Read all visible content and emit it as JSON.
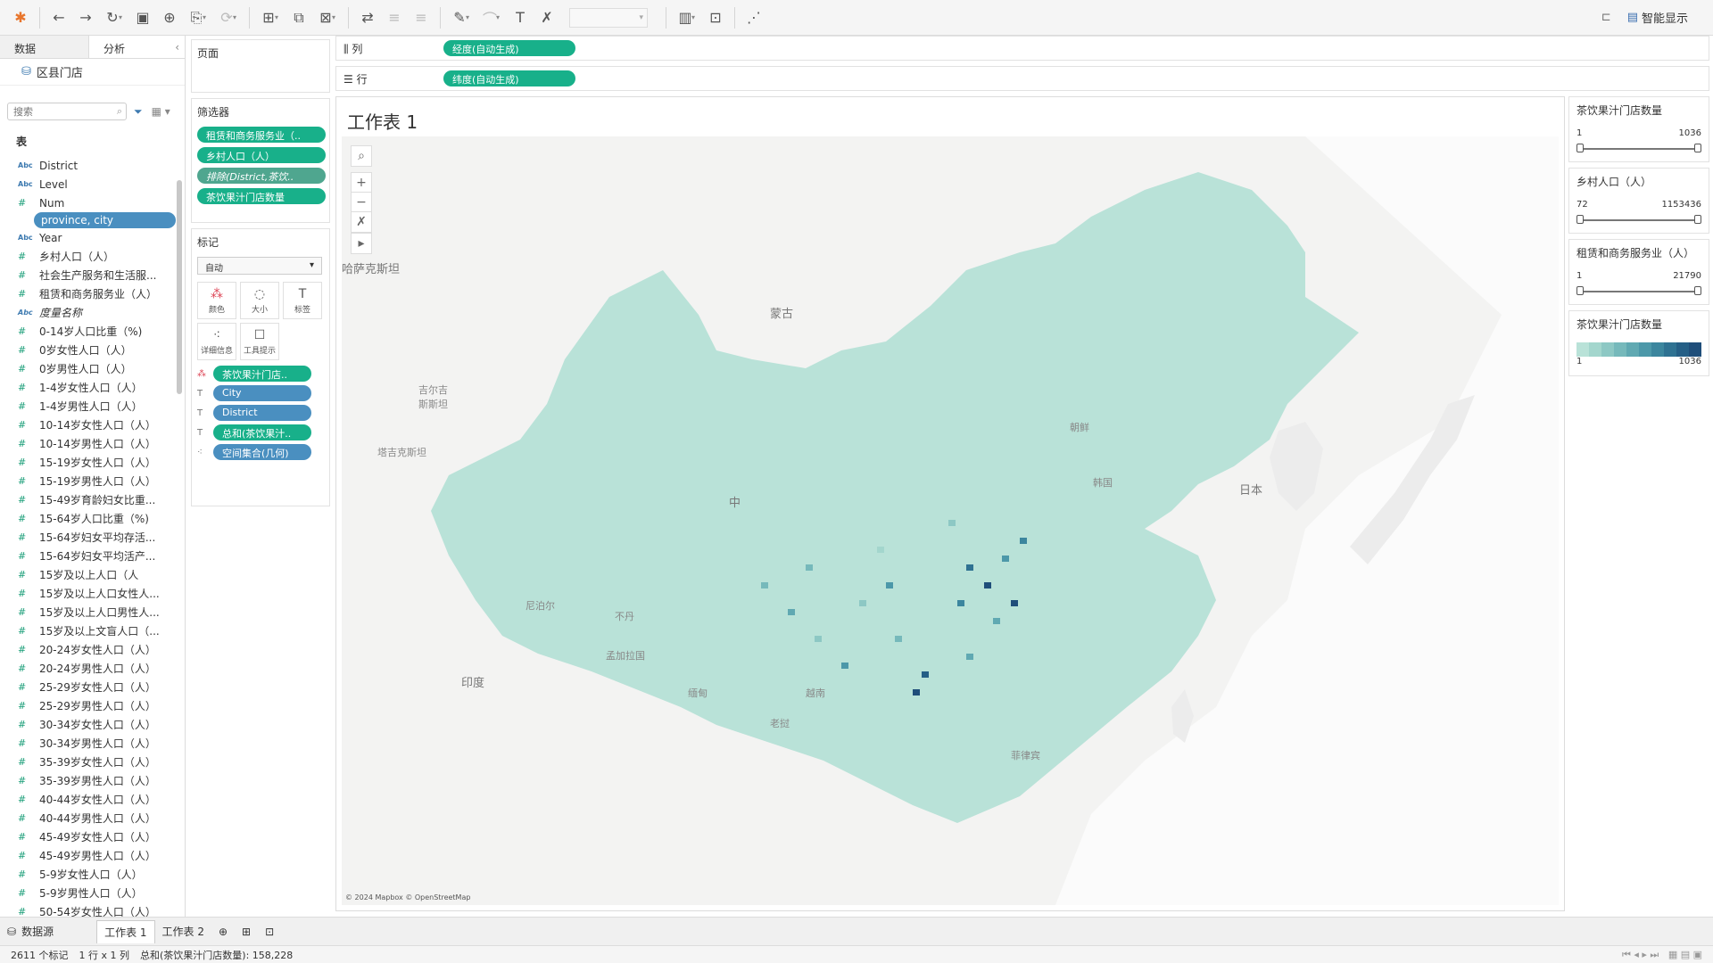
{
  "toolbar": {
    "smart_display": "智能显示"
  },
  "left": {
    "tabs": [
      "数据",
      "分析"
    ],
    "datasource": "区县门店",
    "search_placeholder": "搜索",
    "section": "表",
    "fields": [
      {
        "type": "Abc",
        "name": "District"
      },
      {
        "type": "Abc",
        "name": "Level"
      },
      {
        "type": "#",
        "name": "Num"
      },
      {
        "type": "geo",
        "name": "province, city",
        "selected": true
      },
      {
        "type": "Abc",
        "name": "Year"
      },
      {
        "type": "#",
        "name": "乡村人口（人）"
      },
      {
        "type": "#",
        "name": "社会生产服务和生活服..."
      },
      {
        "type": "#",
        "name": "租赁和商务服务业（人）"
      },
      {
        "type": "Abc",
        "name": "度量名称",
        "italic": true
      },
      {
        "type": "#",
        "name": "0-14岁人口比重（%)"
      },
      {
        "type": "#",
        "name": "0岁女性人口（人）"
      },
      {
        "type": "#",
        "name": "0岁男性人口（人）"
      },
      {
        "type": "#",
        "name": "1-4岁女性人口（人）"
      },
      {
        "type": "#",
        "name": "1-4岁男性人口（人）"
      },
      {
        "type": "#",
        "name": "10-14岁女性人口（人）"
      },
      {
        "type": "#",
        "name": "10-14岁男性人口（人）"
      },
      {
        "type": "#",
        "name": "15-19岁女性人口（人）"
      },
      {
        "type": "#",
        "name": "15-19岁男性人口（人）"
      },
      {
        "type": "#",
        "name": "15-49岁育龄妇女比重..."
      },
      {
        "type": "#",
        "name": "15-64岁人口比重（%)"
      },
      {
        "type": "#",
        "name": "15-64岁妇女平均存活..."
      },
      {
        "type": "#",
        "name": "15-64岁妇女平均活产..."
      },
      {
        "type": "#",
        "name": "15岁及以上人口（人"
      },
      {
        "type": "#",
        "name": "15岁及以上人口女性人..."
      },
      {
        "type": "#",
        "name": "15岁及以上人口男性人..."
      },
      {
        "type": "#",
        "name": "15岁及以上文盲人口（..."
      },
      {
        "type": "#",
        "name": "20-24岁女性人口（人）"
      },
      {
        "type": "#",
        "name": "20-24岁男性人口（人）"
      },
      {
        "type": "#",
        "name": "25-29岁女性人口（人）"
      },
      {
        "type": "#",
        "name": "25-29岁男性人口（人）"
      },
      {
        "type": "#",
        "name": "30-34岁女性人口（人）"
      },
      {
        "type": "#",
        "name": "30-34岁男性人口（人）"
      },
      {
        "type": "#",
        "name": "35-39岁女性人口（人）"
      },
      {
        "type": "#",
        "name": "35-39岁男性人口（人）"
      },
      {
        "type": "#",
        "name": "40-44岁女性人口（人）"
      },
      {
        "type": "#",
        "name": "40-44岁男性人口（人）"
      },
      {
        "type": "#",
        "name": "45-49岁女性人口（人）"
      },
      {
        "type": "#",
        "name": "45-49岁男性人口（人）"
      },
      {
        "type": "#",
        "name": "5-9岁女性人口（人）"
      },
      {
        "type": "#",
        "name": "5-9岁男性人口（人）"
      },
      {
        "type": "#",
        "name": "50-54岁女性人口（人）"
      }
    ]
  },
  "pages": {
    "title": "页面"
  },
  "filters": {
    "title": "筛选器",
    "items": [
      "租赁和商务服务业（..",
      "乡村人口（人）",
      "排除(District,茶饮..",
      "茶饮果汁门店数量"
    ]
  },
  "marks": {
    "title": "标记",
    "type": "自动",
    "cells": [
      "颜色",
      "大小",
      "标签",
      "详细信息",
      "工具提示"
    ],
    "pills": [
      "茶饮果汁门店..",
      "City",
      "District",
      "总和(茶饮果汁..",
      "空间集合(几何)"
    ]
  },
  "shelves": {
    "columns_label": "列",
    "columns_pill": "经度(自动生成)",
    "rows_label": "行",
    "rows_pill": "纬度(自动生成)"
  },
  "view": {
    "title": "工作表 1",
    "attribution": "© 2024 Mapbox © OpenStreetMap",
    "labels": [
      "蒙古",
      "哈萨克斯坦",
      "吉尔吉斯斯坦",
      "塔吉克斯坦",
      "中",
      "尼泊尔",
      "不丹",
      "孟加拉国",
      "印度",
      "缅甸",
      "老挝",
      "越南",
      "朝鲜",
      "韩国",
      "日本",
      "菲律宾"
    ]
  },
  "legends": [
    {
      "title": "茶饮果汁门店数量",
      "min": "1",
      "max": "1036"
    },
    {
      "title": "乡村人口（人）",
      "min": "72",
      "max": "1153436"
    },
    {
      "title": "租赁和商务服务业（人）",
      "min": "1",
      "max": "21790"
    },
    {
      "title": "茶饮果汁门店数量",
      "min": "1",
      "max": "1036"
    }
  ],
  "colors": {
    "fill_low": "#b9e2d8",
    "fill_high": "#1f4e7a",
    "pill_green": "#18b08a",
    "pill_blue": "#4a8fc0"
  },
  "sheets": {
    "datasource": "数据源",
    "tabs": [
      "工作表 1",
      "工作表 2"
    ]
  },
  "status": {
    "marks": "2611 个标记",
    "rows_cols": "1 行 x 1 列",
    "sum": "总和(茶饮果汁门店数量): 158,228"
  }
}
